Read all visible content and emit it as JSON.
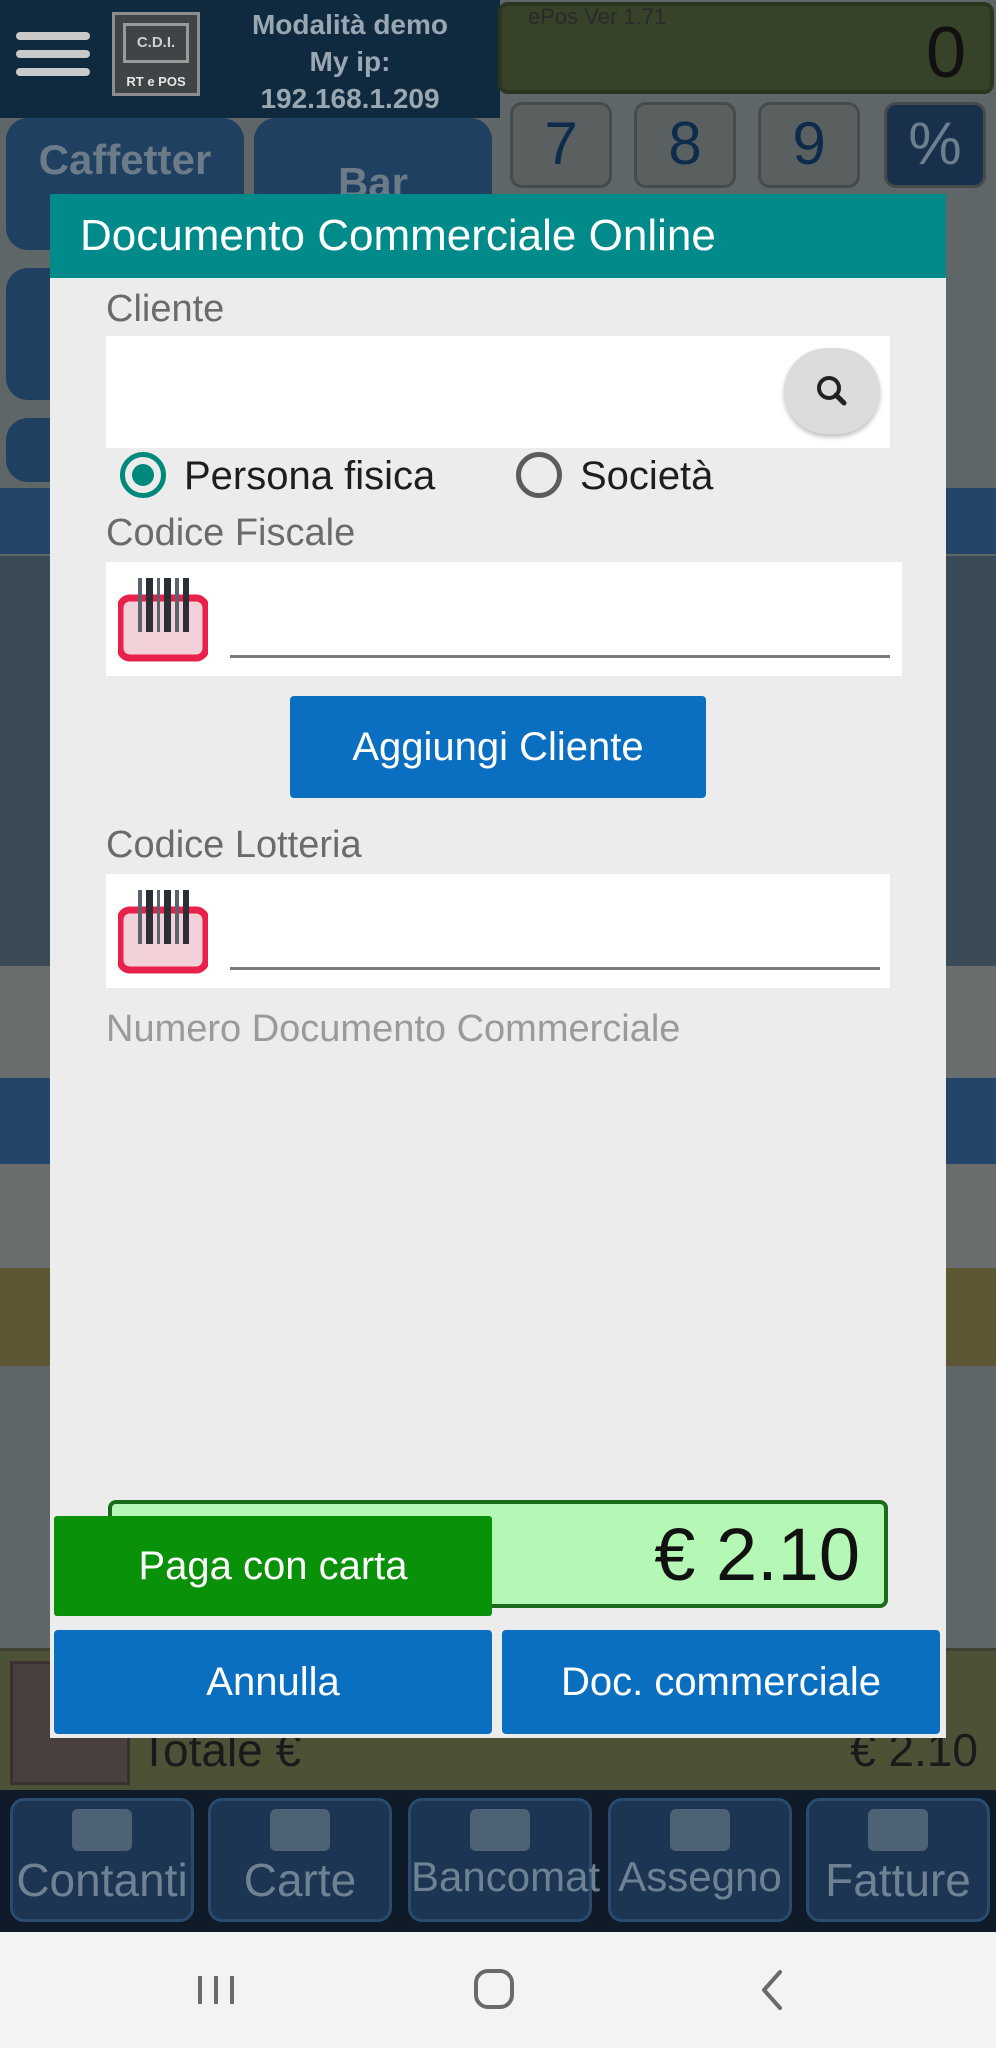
{
  "app": {
    "demo_line1": "Modalità demo",
    "demo_line2": "My ip:",
    "demo_line3": "192.168.1.209",
    "logo_top": "C.D.I.",
    "logo_bottom": "RT e POS",
    "display_version": "ePos Ver 1.71",
    "display_value": "0",
    "keys": [
      "7",
      "8",
      "9",
      "%"
    ],
    "categories": [
      "Caffetter",
      "Bar"
    ],
    "total_label": "Totale €",
    "total_value": "€ 2.10",
    "payment_buttons": [
      "Contanti",
      "Carte",
      "Bancomat",
      "Assegno",
      "Fatture"
    ]
  },
  "dialog": {
    "title": "Documento Commerciale Online",
    "cliente_label": "Cliente",
    "cliente_value": "",
    "radio_persona": "Persona fisica",
    "radio_societa": "Società",
    "radio_selected": "persona",
    "codice_fiscale_label": "Codice Fiscale",
    "codice_fiscale_value": "",
    "add_client_label": "Aggiungi Cliente",
    "codice_lotteria_label": "Codice Lotteria",
    "codice_lotteria_value": "",
    "numero_doc_label": "Numero Documento Commerciale",
    "amount": "€ 2.10",
    "pay_card_label": "Paga con carta",
    "cancel_label": "Annulla",
    "doc_label": "Doc. commerciale"
  },
  "colors": {
    "title_bar": "#008a8a",
    "primary_button": "#0a6fc1",
    "pay_button": "#0a910a",
    "amount_bg": "#b5f7b5",
    "radio_accent": "#00897b"
  },
  "icons": {
    "menu": "hamburger-icon",
    "search": "search-icon",
    "barcode": "barcode-scanner-icon",
    "nav_recent": "recent-apps-icon",
    "nav_home": "home-icon",
    "nav_back": "back-icon"
  }
}
